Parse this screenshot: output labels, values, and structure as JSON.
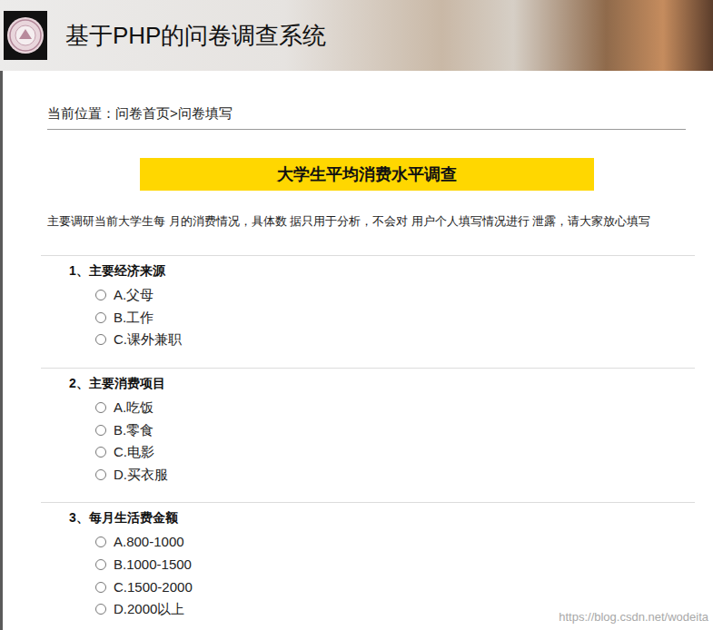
{
  "header": {
    "title": "基于PHP的问卷调查系统"
  },
  "breadcrumb": {
    "label": "当前位置：",
    "path": "问卷首页>问卷填写"
  },
  "survey": {
    "title": "大学生平均消费水平调查",
    "description": "主要调研当前大学生每 月的消费情况，具体数 据只用于分析，不会对 用户个人填写情况进行 泄露，请大家放心填写"
  },
  "questions": [
    {
      "title": "1、主要经济来源",
      "options": [
        {
          "label": "A.父母",
          "selected": false
        },
        {
          "label": "B.工作",
          "selected": false
        },
        {
          "label": "C.课外兼职",
          "selected": false
        }
      ]
    },
    {
      "title": "2、主要消费项目",
      "options": [
        {
          "label": "A.吃饭",
          "selected": false
        },
        {
          "label": "B.零食",
          "selected": false
        },
        {
          "label": "C.电影",
          "selected": false
        },
        {
          "label": "D.买衣服",
          "selected": false
        }
      ]
    },
    {
      "title": "3、每月生活费金额",
      "options": [
        {
          "label": "A.800-1000",
          "selected": false
        },
        {
          "label": "B.1000-1500",
          "selected": false
        },
        {
          "label": "C.1500-2000",
          "selected": false
        },
        {
          "label": "D.2000以上",
          "selected": false
        }
      ]
    }
  ],
  "watermark": "https://blog.csdn.net/wodeita"
}
